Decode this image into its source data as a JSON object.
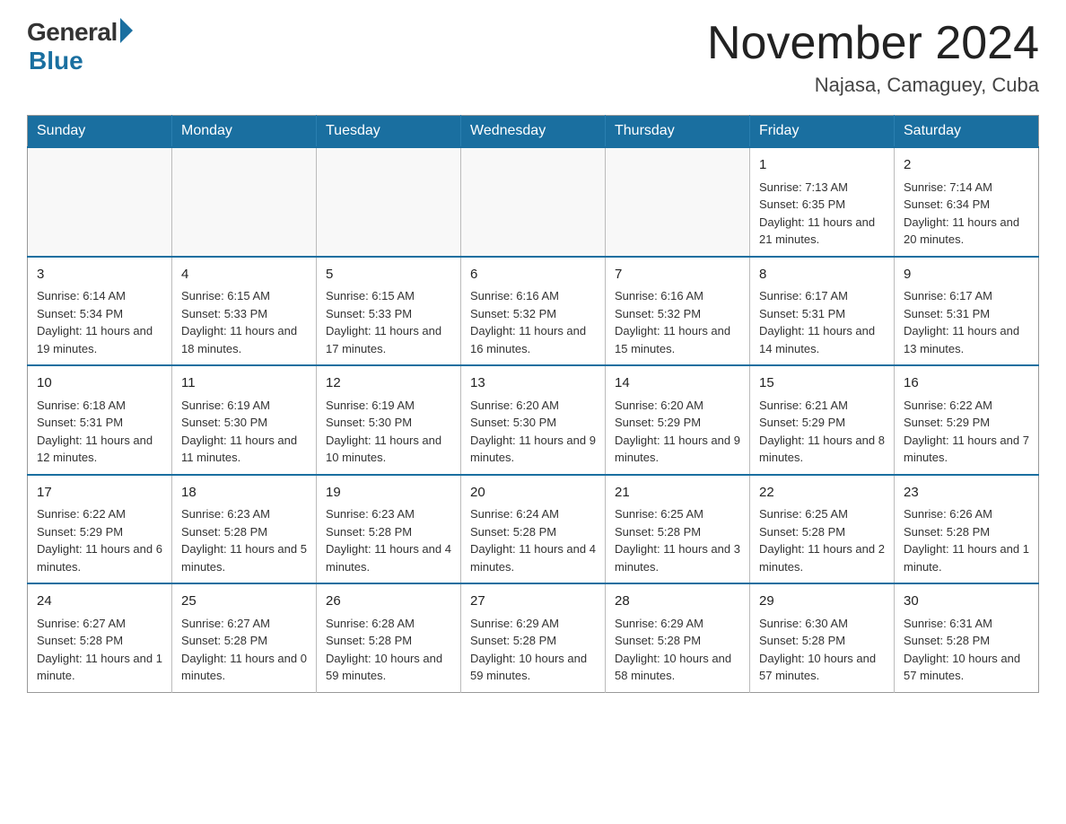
{
  "header": {
    "logo": {
      "general": "General",
      "blue": "Blue"
    },
    "title": "November 2024",
    "location": "Najasa, Camaguey, Cuba"
  },
  "days_of_week": [
    "Sunday",
    "Monday",
    "Tuesday",
    "Wednesday",
    "Thursday",
    "Friday",
    "Saturday"
  ],
  "weeks": [
    {
      "days": [
        {
          "number": "",
          "empty": true
        },
        {
          "number": "",
          "empty": true
        },
        {
          "number": "",
          "empty": true
        },
        {
          "number": "",
          "empty": true
        },
        {
          "number": "",
          "empty": true
        },
        {
          "number": "1",
          "sunrise": "7:13 AM",
          "sunset": "6:35 PM",
          "daylight": "11 hours and 21 minutes."
        },
        {
          "number": "2",
          "sunrise": "7:14 AM",
          "sunset": "6:34 PM",
          "daylight": "11 hours and 20 minutes."
        }
      ]
    },
    {
      "days": [
        {
          "number": "3",
          "sunrise": "6:14 AM",
          "sunset": "5:34 PM",
          "daylight": "11 hours and 19 minutes."
        },
        {
          "number": "4",
          "sunrise": "6:15 AM",
          "sunset": "5:33 PM",
          "daylight": "11 hours and 18 minutes."
        },
        {
          "number": "5",
          "sunrise": "6:15 AM",
          "sunset": "5:33 PM",
          "daylight": "11 hours and 17 minutes."
        },
        {
          "number": "6",
          "sunrise": "6:16 AM",
          "sunset": "5:32 PM",
          "daylight": "11 hours and 16 minutes."
        },
        {
          "number": "7",
          "sunrise": "6:16 AM",
          "sunset": "5:32 PM",
          "daylight": "11 hours and 15 minutes."
        },
        {
          "number": "8",
          "sunrise": "6:17 AM",
          "sunset": "5:31 PM",
          "daylight": "11 hours and 14 minutes."
        },
        {
          "number": "9",
          "sunrise": "6:17 AM",
          "sunset": "5:31 PM",
          "daylight": "11 hours and 13 minutes."
        }
      ]
    },
    {
      "days": [
        {
          "number": "10",
          "sunrise": "6:18 AM",
          "sunset": "5:31 PM",
          "daylight": "11 hours and 12 minutes."
        },
        {
          "number": "11",
          "sunrise": "6:19 AM",
          "sunset": "5:30 PM",
          "daylight": "11 hours and 11 minutes."
        },
        {
          "number": "12",
          "sunrise": "6:19 AM",
          "sunset": "5:30 PM",
          "daylight": "11 hours and 10 minutes."
        },
        {
          "number": "13",
          "sunrise": "6:20 AM",
          "sunset": "5:30 PM",
          "daylight": "11 hours and 9 minutes."
        },
        {
          "number": "14",
          "sunrise": "6:20 AM",
          "sunset": "5:29 PM",
          "daylight": "11 hours and 9 minutes."
        },
        {
          "number": "15",
          "sunrise": "6:21 AM",
          "sunset": "5:29 PM",
          "daylight": "11 hours and 8 minutes."
        },
        {
          "number": "16",
          "sunrise": "6:22 AM",
          "sunset": "5:29 PM",
          "daylight": "11 hours and 7 minutes."
        }
      ]
    },
    {
      "days": [
        {
          "number": "17",
          "sunrise": "6:22 AM",
          "sunset": "5:29 PM",
          "daylight": "11 hours and 6 minutes."
        },
        {
          "number": "18",
          "sunrise": "6:23 AM",
          "sunset": "5:28 PM",
          "daylight": "11 hours and 5 minutes."
        },
        {
          "number": "19",
          "sunrise": "6:23 AM",
          "sunset": "5:28 PM",
          "daylight": "11 hours and 4 minutes."
        },
        {
          "number": "20",
          "sunrise": "6:24 AM",
          "sunset": "5:28 PM",
          "daylight": "11 hours and 4 minutes."
        },
        {
          "number": "21",
          "sunrise": "6:25 AM",
          "sunset": "5:28 PM",
          "daylight": "11 hours and 3 minutes."
        },
        {
          "number": "22",
          "sunrise": "6:25 AM",
          "sunset": "5:28 PM",
          "daylight": "11 hours and 2 minutes."
        },
        {
          "number": "23",
          "sunrise": "6:26 AM",
          "sunset": "5:28 PM",
          "daylight": "11 hours and 1 minute."
        }
      ]
    },
    {
      "days": [
        {
          "number": "24",
          "sunrise": "6:27 AM",
          "sunset": "5:28 PM",
          "daylight": "11 hours and 1 minute."
        },
        {
          "number": "25",
          "sunrise": "6:27 AM",
          "sunset": "5:28 PM",
          "daylight": "11 hours and 0 minutes."
        },
        {
          "number": "26",
          "sunrise": "6:28 AM",
          "sunset": "5:28 PM",
          "daylight": "10 hours and 59 minutes."
        },
        {
          "number": "27",
          "sunrise": "6:29 AM",
          "sunset": "5:28 PM",
          "daylight": "10 hours and 59 minutes."
        },
        {
          "number": "28",
          "sunrise": "6:29 AM",
          "sunset": "5:28 PM",
          "daylight": "10 hours and 58 minutes."
        },
        {
          "number": "29",
          "sunrise": "6:30 AM",
          "sunset": "5:28 PM",
          "daylight": "10 hours and 57 minutes."
        },
        {
          "number": "30",
          "sunrise": "6:31 AM",
          "sunset": "5:28 PM",
          "daylight": "10 hours and 57 minutes."
        }
      ]
    }
  ],
  "labels": {
    "sunrise": "Sunrise:",
    "sunset": "Sunset:",
    "daylight": "Daylight:"
  }
}
